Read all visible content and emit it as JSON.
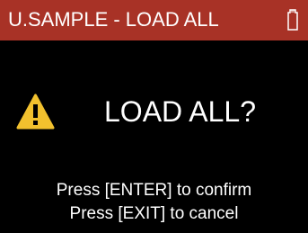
{
  "header": {
    "title": "U.SAMPLE - LOAD ALL",
    "device_icon": "memory-card-icon",
    "background_color": "#a83226"
  },
  "dialog": {
    "icon": "warning-icon",
    "icon_color": "#f2c12e",
    "question": "LOAD ALL?",
    "confirm_text": "Press [ENTER] to confirm",
    "cancel_text": "Press [EXIT] to cancel"
  }
}
